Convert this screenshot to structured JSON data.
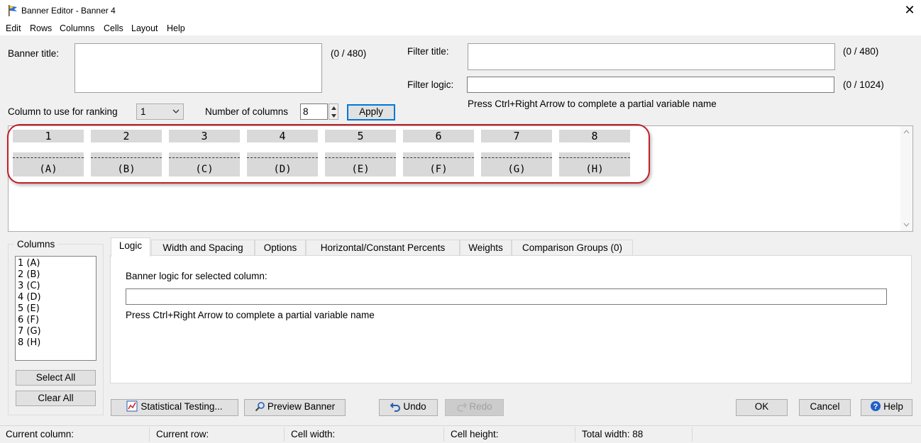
{
  "window": {
    "title": "Banner Editor - Banner 4",
    "close_label": "✕"
  },
  "menu": [
    "Edit",
    "Rows",
    "Columns",
    "Cells",
    "Layout",
    "Help"
  ],
  "banner_title": {
    "label": "Banner title:",
    "value": "",
    "counter": "(0 / 480)"
  },
  "filter_title": {
    "label": "Filter title:",
    "value": "",
    "counter": "(0 / 480)"
  },
  "filter_logic": {
    "label": "Filter logic:",
    "value": "",
    "counter": "(0 / 1024)",
    "hint": "Press Ctrl+Right Arrow to complete a partial variable name"
  },
  "ranking": {
    "label": "Column to use for ranking",
    "value": "1"
  },
  "num_columns": {
    "label": "Number of columns",
    "value": "8"
  },
  "apply_label": "Apply",
  "banner_columns": [
    {
      "num": "1",
      "letter": "(A)"
    },
    {
      "num": "2",
      "letter": "(B)"
    },
    {
      "num": "3",
      "letter": "(C)"
    },
    {
      "num": "4",
      "letter": "(D)"
    },
    {
      "num": "5",
      "letter": "(E)"
    },
    {
      "num": "6",
      "letter": "(F)"
    },
    {
      "num": "7",
      "letter": "(G)"
    },
    {
      "num": "8",
      "letter": "(H)"
    }
  ],
  "columns_group": {
    "label": "Columns",
    "items": [
      "1 (A)",
      "2 (B)",
      "3 (C)",
      "4 (D)",
      "5 (E)",
      "6 (F)",
      "7 (G)",
      "8 (H)"
    ],
    "select_all": "Select All",
    "clear_all": "Clear All"
  },
  "tabs": [
    "Logic",
    "Width and Spacing",
    "Options",
    "Horizontal/Constant Percents",
    "Weights",
    "Comparison Groups (0)"
  ],
  "logic_panel": {
    "label": "Banner logic for selected column:",
    "value": "",
    "hint": "Press Ctrl+Right Arrow to complete a partial variable name"
  },
  "buttons": {
    "statistical_testing": "Statistical Testing...",
    "preview_banner": "Preview Banner",
    "undo": "Undo",
    "redo": "Redo",
    "ok": "OK",
    "cancel": "Cancel",
    "help": "Help"
  },
  "status": {
    "current_column": "Current column:",
    "current_row": "Current row:",
    "cell_width": "Cell width:",
    "cell_height": "Cell height:",
    "total_width": "Total width: 88"
  },
  "colors": {
    "accent": "#0078d7",
    "highlight": "#c0202a"
  }
}
